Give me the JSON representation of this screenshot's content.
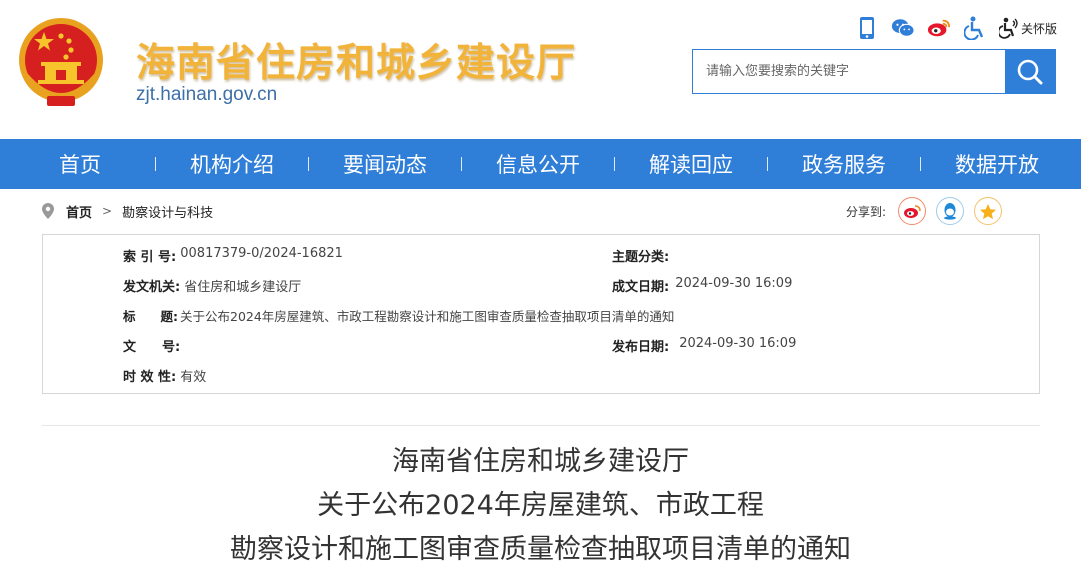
{
  "site": {
    "title": "海南省住房和城乡建设厅",
    "domain": "zjt.hainan.gov.cn"
  },
  "tools": {
    "icons": [
      "mobile-icon",
      "wechat-icon",
      "weibo-icon",
      "accessibility-icon",
      "care-mode-icon"
    ],
    "care_label": "关怀版"
  },
  "search": {
    "placeholder": "请输入您要搜索的关键字"
  },
  "nav": {
    "items": [
      "首页",
      "机构介绍",
      "要闻动态",
      "信息公开",
      "解读回应",
      "政务服务",
      "数据开放"
    ]
  },
  "breadcrumb": {
    "home": "首页",
    "current": "勘察设计与科技"
  },
  "share": {
    "label": "分享到:",
    "targets": [
      "weibo-share-icon",
      "qq-share-icon",
      "qzone-share-icon"
    ]
  },
  "info": {
    "index_label": "索 引 号:",
    "index_value": "00817379-0/2024-16821",
    "topic_label": "主题分类:",
    "topic_value": "",
    "issuer_label": "发文机关:",
    "issuer_value": "省住房和城乡建设厅",
    "created_label": "成文日期:",
    "created_value": "2024-09-30 16:09",
    "title_label": "标　　题:",
    "title_value": "关于公布2024年房屋建筑、市政工程勘察设计和施工图审查质量检查抽取项目清单的通知",
    "docno_label": "文　　号:",
    "docno_value": "",
    "published_label": "发布日期:",
    "published_value": "2024-09-30 16:09",
    "validity_label": "时 效 性:",
    "validity_value": "有效"
  },
  "document": {
    "title_line1": "海南省住房和城乡建设厅",
    "title_line2": "关于公布2024年房屋建筑、市政工程",
    "title_line3": "勘察设计和施工图审查质量检查抽取项目清单的通知"
  },
  "colors": {
    "brand_blue": "#2f7ed8",
    "title_gold": "#f2b33a",
    "emblem_red": "#d6201f"
  }
}
